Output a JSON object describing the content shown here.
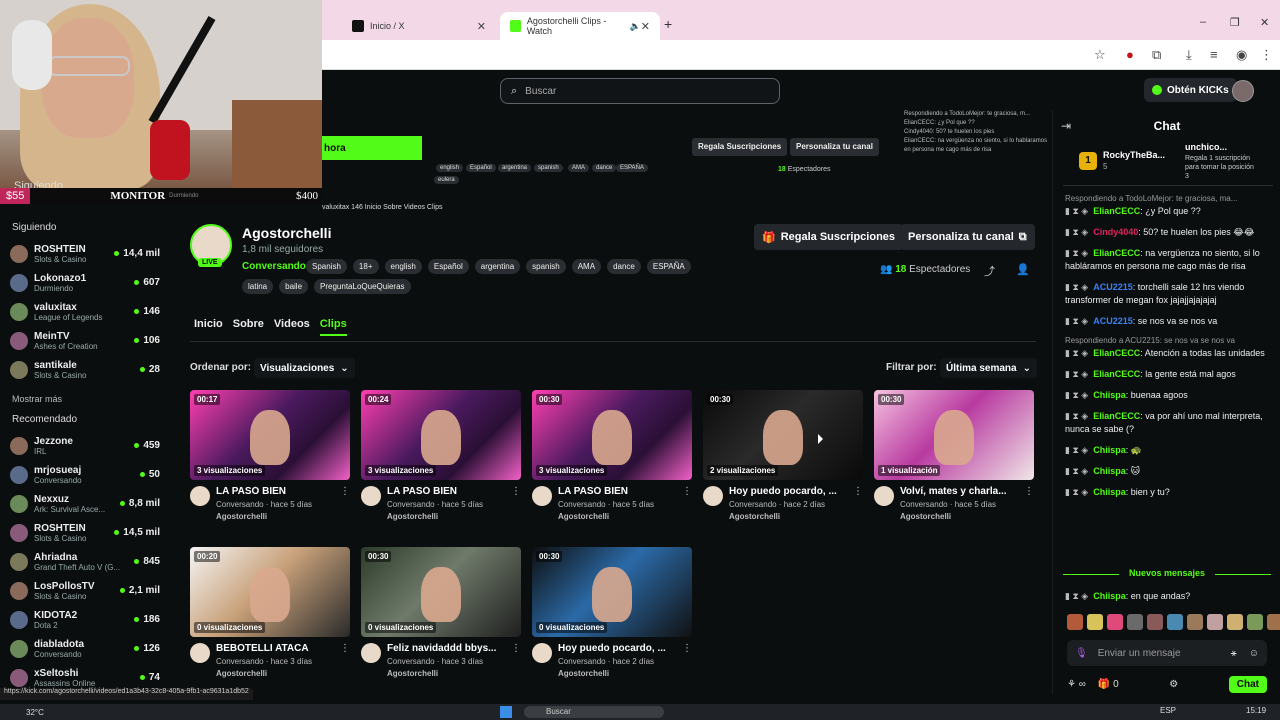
{
  "browser": {
    "tabs": [
      {
        "title": "Inicio / X",
        "active": false
      },
      {
        "title": "Agostorchelli Clips - Watch",
        "active": true
      }
    ],
    "new_tab": "+",
    "window_controls": [
      "–",
      "❐",
      "✕"
    ]
  },
  "kick_header": {
    "search_placeholder": "Buscar",
    "kicks_button": "Obtén KICKs"
  },
  "overlay": {
    "siguiendo": "Siguiendo",
    "money_left": "$55",
    "monitor": "MONITOR",
    "monitor_sub": "Durmiendo",
    "money_right": "$400"
  },
  "mini_strip": {
    "follow_label": "hora",
    "tags": [
      "english",
      "Español",
      "argentina",
      "spanish",
      "AMA",
      "dance",
      "ESPAÑA"
    ],
    "tag_extra": "eulera",
    "gift_label": "Regala Suscripciones",
    "custom_label": "Personaliza tu canal",
    "viewers_num": "18",
    "viewers_label": "Espectadores",
    "tabs_line": "valuxitax   146   Inicio   Sobre   Videos   Clips",
    "chat_lines": [
      "Respondiendo a TodoLoMejor: te graciosa, m...",
      "ElianCECC: ¿y Pol que ??",
      "Cindy4040: 50? te huelen los pies",
      "ElianCECC: na vergüenza no siento, si lo hablaramos en persona me cago más de risa"
    ]
  },
  "sidebar": {
    "following_title": "Siguiendo",
    "following": [
      {
        "name": "ROSHTEIN",
        "category": "Slots & Casino",
        "viewers": "14,4 mil"
      },
      {
        "name": "Lokonazo1",
        "category": "Durmiendo",
        "viewers": "607"
      },
      {
        "name": "valuxitax",
        "category": "League of Legends",
        "viewers": "146"
      },
      {
        "name": "MeinTV",
        "category": "Ashes of Creation",
        "viewers": "106"
      },
      {
        "name": "santikale",
        "category": "Slots & Casino",
        "viewers": "28"
      }
    ],
    "show_more": "Mostrar más",
    "recommended_title": "Recomendado",
    "recommended": [
      {
        "name": "Jezzone",
        "category": "IRL",
        "viewers": "459"
      },
      {
        "name": "mrjosueaj",
        "category": "Conversando",
        "viewers": "50"
      },
      {
        "name": "Nexxuz",
        "category": "Ark: Survival Asce...",
        "viewers": "8,8 mil"
      },
      {
        "name": "ROSHTEIN",
        "category": "Slots & Casino",
        "viewers": "14,5 mil"
      },
      {
        "name": "Ahriadna",
        "category": "Grand Theft Auto V (G...",
        "viewers": "845"
      },
      {
        "name": "LosPollosTV",
        "category": "Slots & Casino",
        "viewers": "2,1 mil"
      },
      {
        "name": "KIDOTA2",
        "category": "Dota 2",
        "viewers": "186"
      },
      {
        "name": "diabladota",
        "category": "Conversando",
        "viewers": "126"
      },
      {
        "name": "xSeltoshi",
        "category": "Assassins Online",
        "viewers": "74"
      }
    ]
  },
  "channel": {
    "name": "Agostorchelli",
    "followers": "1,8 mil seguidores",
    "live": "LIVE",
    "category": "Conversando",
    "tags": [
      "Spanish",
      "18+",
      "english",
      "Español",
      "argentina",
      "spanish",
      "AMA",
      "dance",
      "ESPAÑA"
    ],
    "tags2": [
      "latina",
      "baile",
      "PreguntaLoQueQuieras"
    ],
    "gift_button": "Regala Suscripciones",
    "custom_button": "Personaliza tu canal",
    "viewers_num": "18",
    "viewers_label": "Espectadores"
  },
  "tabs": [
    "Inicio",
    "Sobre",
    "Videos",
    "Clips"
  ],
  "sort": {
    "label": "Ordenar por:",
    "value": "Visualizaciones"
  },
  "filter": {
    "label": "Filtrar por:",
    "value": "Última semana"
  },
  "clips": [
    {
      "duration": "00:17",
      "views": "3 visualizaciones",
      "title": "LA PASÓ BIEN",
      "sub": "Conversando · hace 5 días",
      "channel": "Agostorchelli"
    },
    {
      "duration": "00:24",
      "views": "3 visualizaciones",
      "title": "LA PASÓ BIEN",
      "sub": "Conversando · hace 5 días",
      "channel": "Agostorchelli"
    },
    {
      "duration": "00:30",
      "views": "3 visualizaciones",
      "title": "LA PASÓ BIEN",
      "sub": "Conversando · hace 5 días",
      "channel": "Agostorchelli"
    },
    {
      "duration": "00:30",
      "views": "2 visualizaciones",
      "title": "Hoy puedo pocardo, ...",
      "sub": "Conversando · hace 2 días",
      "channel": "Agostorchelli"
    },
    {
      "duration": "00:30",
      "views": "1 visualización",
      "title": "Volví, mates y charla...",
      "sub": "Conversando · hace 5 días",
      "channel": "Agostorchelli"
    },
    {
      "duration": "00:20",
      "views": "0 visualizaciones",
      "title": "BEBOTELLI ATACA",
      "sub": "Conversando · hace 3 días",
      "channel": "Agostorchelli"
    },
    {
      "duration": "00:30",
      "views": "0 visualizaciones",
      "title": "Feliz navidaddd bbys...",
      "sub": "Conversando · hace 3 días",
      "channel": "Agostorchelli"
    },
    {
      "duration": "00:30",
      "views": "0 visualizaciones",
      "title": "Hoy puedo pocardo, ...",
      "sub": "Conversando · hace 2 días",
      "channel": "Agostorchelli"
    }
  ],
  "chat": {
    "title": "Chat",
    "pinned": {
      "rank": "1",
      "top_user": "RockyTheBa...",
      "top_amount": "5",
      "gift_user": "unchico...",
      "gift_amount": "4",
      "gift_text": "Regala 1 suscripción para tomar la posición 3"
    },
    "messages": [
      {
        "reply": "Respondiendo a TodoLoMejor: te graciosa, ma...",
        "user": "ElianCECC",
        "color": "#53fc18",
        "text": ": ¿y Pol que ??"
      },
      {
        "reply": "",
        "user": "Cindy4040",
        "color": "#e0245e",
        "text": ": 50? te huelen los pies 😂😂"
      },
      {
        "reply": "",
        "user": "ElianCECC",
        "color": "#53fc18",
        "text": ": na vergüenza no siento, si lo habláramos en persona me cago más de risa"
      },
      {
        "reply": "",
        "user": "ACU2215",
        "color": "#3b82f6",
        "text": ": torchelli sale 12 hrs viendo transformer de megan fox jajajjajajajaj"
      },
      {
        "reply": "",
        "user": "ACU2215",
        "color": "#3b82f6",
        "text": ": se nos va se nos va"
      },
      {
        "reply": "Respondiendo a ACU2215: se nos va se nos va",
        "user": "ElianCECC",
        "color": "#53fc18",
        "text": ": Atención a todas las unidades"
      },
      {
        "reply": "",
        "user": "ElianCECC",
        "color": "#53fc18",
        "text": ": la gente está mal agos"
      },
      {
        "reply": "",
        "user": "Chiispa",
        "color": "#53fc18",
        "text": ": buenaa agoos"
      },
      {
        "reply": "",
        "user": "ElianCECC",
        "color": "#53fc18",
        "text": ": va por ahí uno mal interpreta, nunca se sabe (?"
      },
      {
        "reply": "",
        "user": "Chiispa",
        "color": "#53fc18",
        "text": ": 🐢"
      },
      {
        "reply": "",
        "user": "Chiispa",
        "color": "#53fc18",
        "text": ": 🐱"
      },
      {
        "reply": "",
        "user": "Chiispa",
        "color": "#53fc18",
        "text": ": bien y tu?"
      }
    ],
    "new_messages": "Nuevos mensajes",
    "last_message": {
      "user": "Chiispa",
      "color": "#53fc18",
      "text": ": en que andas?"
    },
    "input_placeholder": "Enviar un mensaje",
    "kicks_count": "0",
    "send_button": "Chat"
  },
  "status_url": "https://kick.com/agostorchelli/videos/ed1a3b43-32c8-405a-9fb1-ac9631a1db52",
  "taskbar": {
    "temp": "32°C",
    "search": "Buscar",
    "lang": "ESP",
    "time": "15:19"
  }
}
